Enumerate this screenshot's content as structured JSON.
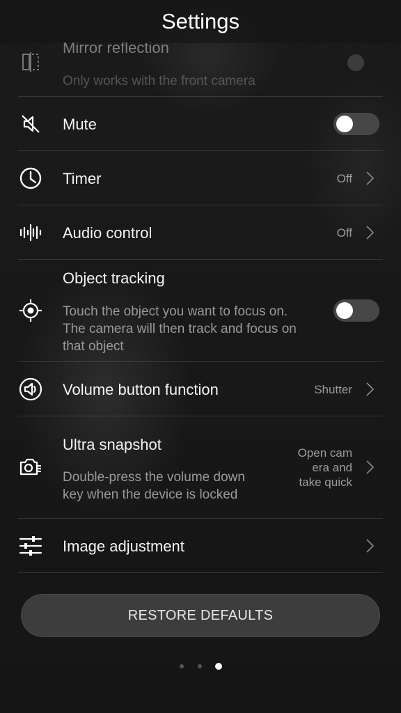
{
  "header": {
    "title": "Settings"
  },
  "settings": {
    "mirror": {
      "label": "Mirror reflection",
      "subtitle": "Only works with the front camera",
      "icon": "mirror-icon"
    },
    "mute": {
      "label": "Mute",
      "toggle": "off",
      "icon": "mute-icon"
    },
    "timer": {
      "label": "Timer",
      "value": "Off",
      "icon": "clock-icon"
    },
    "audio": {
      "label": "Audio control",
      "value": "Off",
      "icon": "audio-wave-icon"
    },
    "tracking": {
      "label": "Object tracking",
      "subtitle_lines": [
        "Touch the object you want to focus on.",
        "The camera will then track and focus on",
        "that object"
      ],
      "toggle": "off",
      "icon": "crosshair-icon"
    },
    "volume": {
      "label": "Volume button function",
      "value": "Shutter",
      "icon": "volume-icon"
    },
    "ultra": {
      "label": "Ultra snapshot",
      "subtitle_lines": [
        "Double-press the volume down",
        "key when the device is locked"
      ],
      "value_lines": [
        "Open cam",
        "era and",
        "take quick"
      ],
      "icon": "camera-icon"
    },
    "image": {
      "label": "Image adjustment",
      "icon": "sliders-icon"
    }
  },
  "footer": {
    "restore_label": "RESTORE DEFAULTS",
    "page_dots": {
      "count": 3,
      "active_index": 2
    }
  },
  "colors": {
    "background": "#141414",
    "toggle_track": "#474747",
    "button": "#3d3d3d"
  }
}
